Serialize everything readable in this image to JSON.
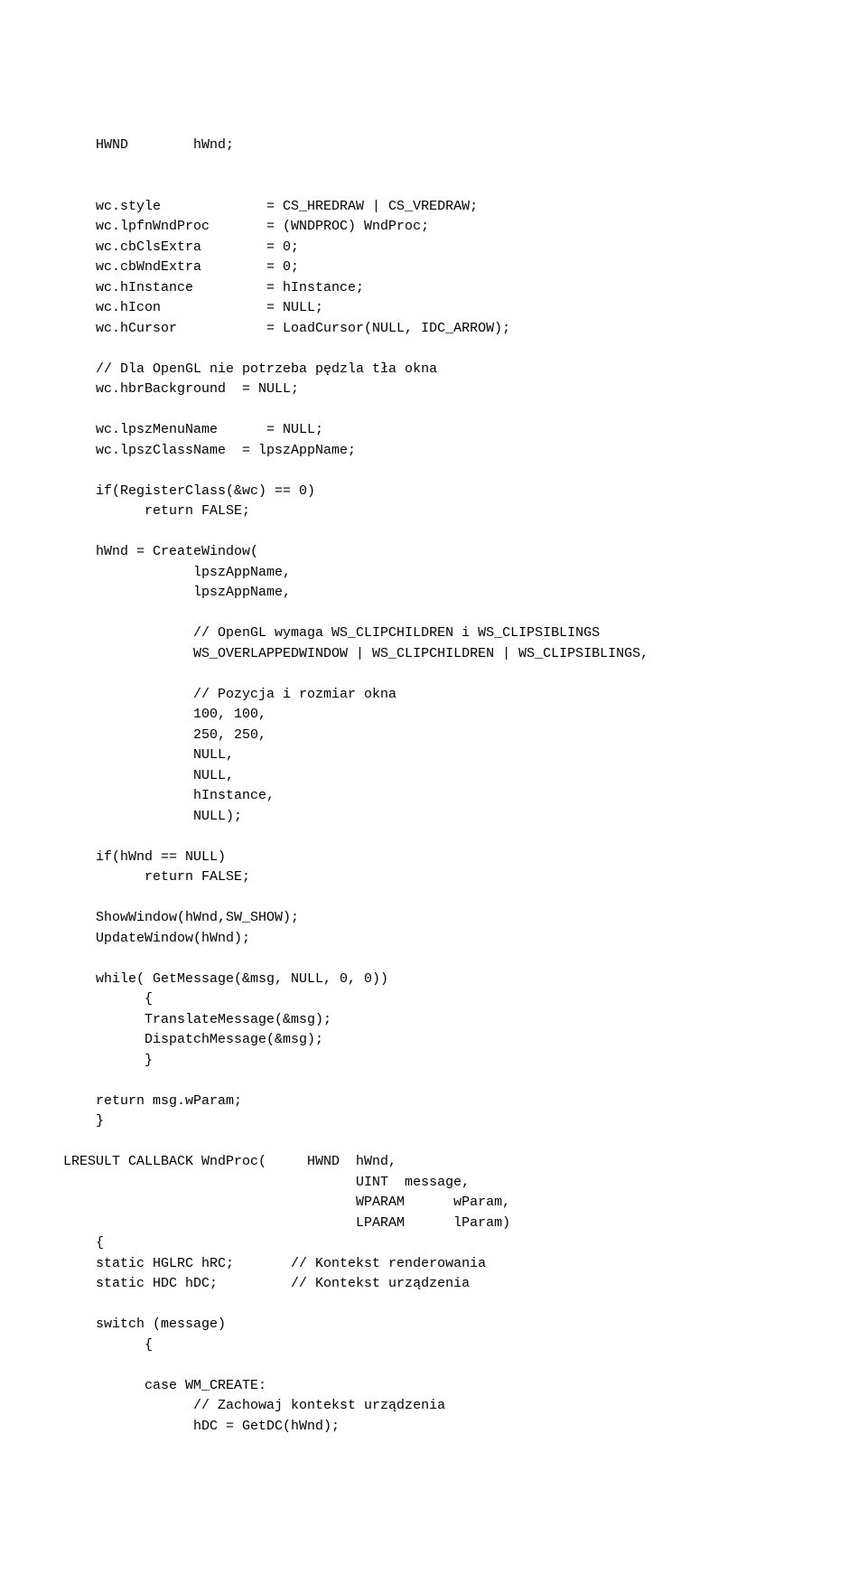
{
  "code": "    HWND        hWnd;\n\n\n    wc.style             = CS_HREDRAW | CS_VREDRAW;\n    wc.lpfnWndProc       = (WNDPROC) WndProc;\n    wc.cbClsExtra        = 0;\n    wc.cbWndExtra        = 0;\n    wc.hInstance         = hInstance;\n    wc.hIcon             = NULL;\n    wc.hCursor           = LoadCursor(NULL, IDC_ARROW);\n\n    // Dla OpenGL nie potrzeba pędzla tła okna\n    wc.hbrBackground  = NULL;\n\n    wc.lpszMenuName      = NULL;\n    wc.lpszClassName  = lpszAppName;\n\n    if(RegisterClass(&wc) == 0)\n          return FALSE;\n\n    hWnd = CreateWindow(\n                lpszAppName,\n                lpszAppName,\n\n                // OpenGL wymaga WS_CLIPCHILDREN i WS_CLIPSIBLINGS\n                WS_OVERLAPPEDWINDOW | WS_CLIPCHILDREN | WS_CLIPSIBLINGS,\n\n                // Pozycja i rozmiar okna\n                100, 100,\n                250, 250,\n                NULL,\n                NULL,\n                hInstance,\n                NULL);\n\n    if(hWnd == NULL)\n          return FALSE;\n\n    ShowWindow(hWnd,SW_SHOW);\n    UpdateWindow(hWnd);\n\n    while( GetMessage(&msg, NULL, 0, 0))\n          {\n          TranslateMessage(&msg);\n          DispatchMessage(&msg);\n          }\n\n    return msg.wParam;\n    }\n\nLRESULT CALLBACK WndProc(     HWND  hWnd,\n                                    UINT  message,\n                                    WPARAM      wParam,\n                                    LPARAM      lParam)\n    {\n    static HGLRC hRC;       // Kontekst renderowania\n    static HDC hDC;         // Kontekst urządzenia\n\n    switch (message)\n          {\n\n          case WM_CREATE:\n                // Zachowaj kontekst urządzenia\n                hDC = GetDC(hWnd);"
}
